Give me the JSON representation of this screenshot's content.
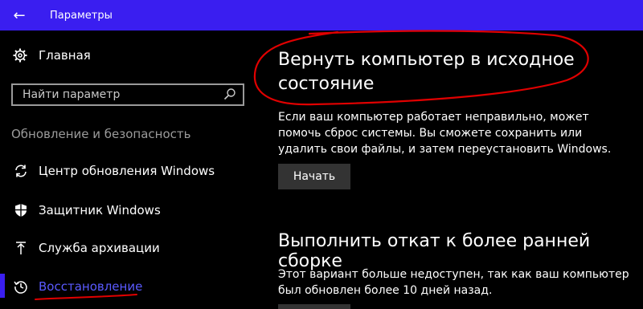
{
  "window": {
    "title": "Параметры"
  },
  "sidebar": {
    "home_label": "Главная",
    "search_placeholder": "Найти параметр",
    "section_label": "Обновление и безопасность",
    "items": [
      {
        "label": "Центр обновления Windows",
        "icon": "sync-icon"
      },
      {
        "label": "Защитник Windows",
        "icon": "shield-icon"
      },
      {
        "label": "Служба архивации",
        "icon": "backup-arrow-icon"
      },
      {
        "label": "Восстановление",
        "icon": "history-icon",
        "active": true
      }
    ]
  },
  "main": {
    "reset": {
      "title": "Вернуть компьютер в исходное состояние",
      "description": "Если ваш компьютер работает неправильно, может помочь сброс системы. Вы сможете сохранить или удалить свои файлы, и затем переустановить Windows.",
      "button_label": "Начать"
    },
    "rollback": {
      "title": "Выполнить откат к более ранней сборке",
      "description": "Этот вариант больше недоступен, так как ваш компьютер был обновлен более 10 дней назад."
    }
  },
  "colors": {
    "accent": "#3a1ef0",
    "annotation": "#e00000"
  }
}
